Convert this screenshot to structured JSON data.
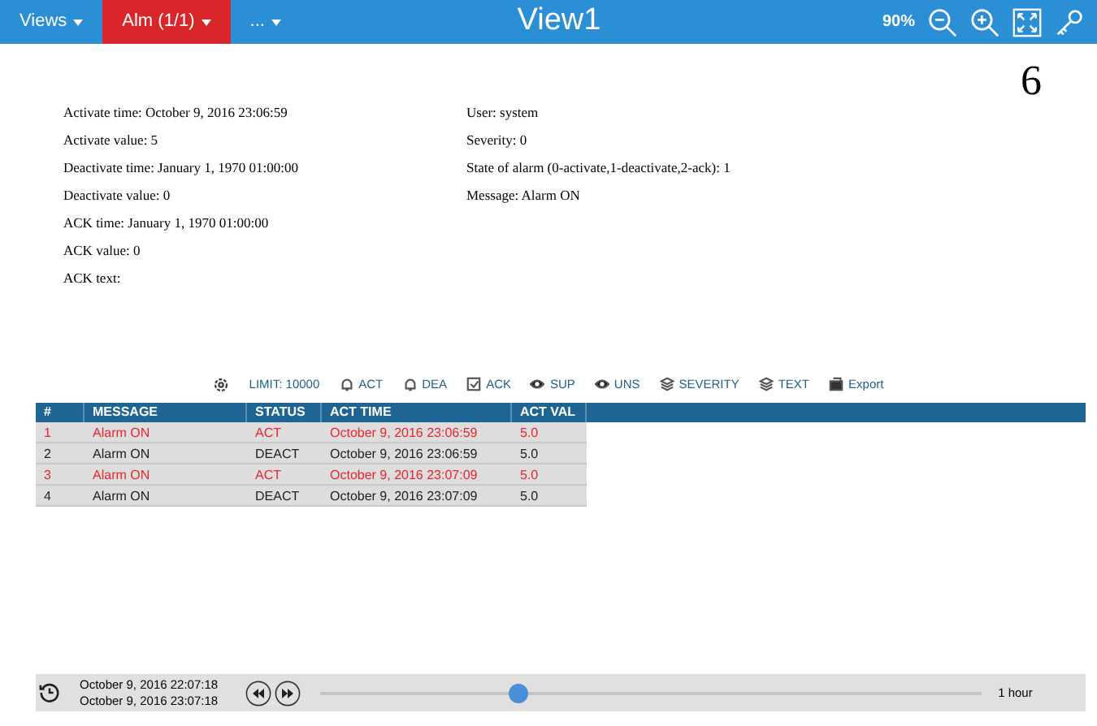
{
  "top_bar": {
    "menus": [
      {
        "label": "Views",
        "selected": false
      },
      {
        "label": "Alm (1/1)",
        "selected": true
      },
      {
        "label": "...",
        "selected": false
      }
    ],
    "title": "View1",
    "zoom": "90%"
  },
  "page_number": "6",
  "details_left": [
    "Activate time: October 9, 2016 23:06:59",
    "Activate value: 5",
    "Deactivate time: January 1, 1970 01:00:00",
    "Deactivate value: 0",
    "ACK time: January 1, 1970 01:00:00",
    "ACK value: 0",
    "ACK text:"
  ],
  "details_right": [
    "User: system",
    "Severity: 0",
    "State of alarm (0-activate,1-deactivate,2-ack): 1",
    "Message: Alarm ON"
  ],
  "toolbar": [
    {
      "kind": "limit",
      "label": "LIMIT: 10000"
    },
    {
      "kind": "bell",
      "label": "ACT"
    },
    {
      "kind": "bell",
      "label": "DEA"
    },
    {
      "kind": "check",
      "label": "ACK"
    },
    {
      "kind": "eye",
      "label": "SUP"
    },
    {
      "kind": "eye",
      "label": "UNS"
    },
    {
      "kind": "layers",
      "label": "SEVERITY"
    },
    {
      "kind": "layers",
      "label": "TEXT"
    },
    {
      "kind": "export",
      "label": "Export"
    }
  ],
  "table": {
    "columns": [
      "#",
      "MESSAGE",
      "STATUS",
      "ACT TIME",
      "ACT VAL"
    ],
    "rows": [
      {
        "active": true,
        "cells": [
          "1",
          "Alarm ON",
          "ACT",
          "October 9, 2016 23:06:59",
          "5.0"
        ]
      },
      {
        "active": false,
        "cells": [
          "2",
          "Alarm ON",
          "DEACT",
          "October 9, 2016 23:06:59",
          "5.0"
        ]
      },
      {
        "active": true,
        "cells": [
          "3",
          "Alarm ON",
          "ACT",
          "October 9, 2016 23:07:09",
          "5.0"
        ]
      },
      {
        "active": false,
        "cells": [
          "4",
          "Alarm ON",
          "DEACT",
          "October 9, 2016 23:07:09",
          "5.0"
        ]
      }
    ]
  },
  "timeline": {
    "start": "October 9, 2016 22:07:18",
    "end": "October 9, 2016 23:07:18",
    "level": 0.3,
    "span": "1 hour"
  }
}
